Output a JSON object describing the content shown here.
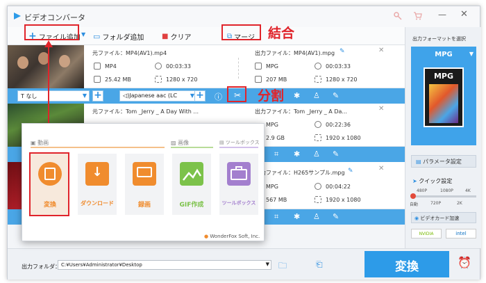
{
  "window": {
    "title": "ビデオコンバータ"
  },
  "toolbar": {
    "add_file": "ファイル追加",
    "add_folder": "フォルダ追加",
    "clear": "クリア",
    "merge": "マージ"
  },
  "annotations": {
    "merge": "結合",
    "split": "分割"
  },
  "files": [
    {
      "src_label": "元ファイル：",
      "src_name": "MP4(AV1).mp4",
      "src_format": "MP4",
      "src_duration": "00:03:33",
      "src_size": "25.42 MB",
      "src_res": "1280 x 720",
      "out_label": "出力ファイル：",
      "out_name": "MP4(AV1).mpg",
      "out_format": "MPG",
      "out_duration": "00:03:33",
      "out_size": "207 MB",
      "out_res": "1280 x 720"
    },
    {
      "src_label": "元ファイル：",
      "src_name": "Tom _Jerry _ A Day With ...",
      "out_label": "出力ファイル：",
      "out_name": "Tom _Jerry _ A Da...",
      "out_format": "MPG",
      "out_duration": "00:22:36",
      "out_size": "2.9 GB",
      "out_res": "1920 x 1080"
    },
    {
      "out_label": "出力ファイル：",
      "out_name": "H265サンプル.mpg",
      "out_format": "MPG",
      "out_duration": "00:04:22",
      "out_size": "567 MB",
      "out_res": "1920 x 1080"
    }
  ],
  "row1_bar": {
    "subtitle": "なし",
    "audio": "Japanese aac (LC"
  },
  "right_panel": {
    "output_format_label": "出力フォーマットを選択",
    "format": "MPG",
    "format_badge": "MPG",
    "param_button": "パラメータ設定",
    "quick_settings": "クイック設定",
    "scale": [
      "480P",
      "1080P",
      "4K"
    ],
    "scale2": [
      "自動",
      "720P",
      "2K"
    ],
    "gpu_accel": "ビデオカード加速",
    "nvidia": "NVIDIA",
    "intel": "intel"
  },
  "bottom": {
    "output_folder_label": "出力フォルダ：",
    "output_path": "C:¥Users¥Administrator¥Desktop",
    "convert_button": "変換"
  },
  "popup": {
    "section_video": "動画",
    "section_image": "画像",
    "section_tools": "ツールボックス",
    "tiles": [
      "変換",
      "ダウンロード",
      "録画",
      "GIF作成",
      "ツールボックス"
    ],
    "footer": "WonderFox Soft, Inc."
  },
  "colors": {
    "accent": "#2d9be8",
    "annotation": "#e0242b",
    "tile_orange": "#f08c2e",
    "tile_green": "#7cc24a",
    "tile_purple": "#a37fce"
  }
}
